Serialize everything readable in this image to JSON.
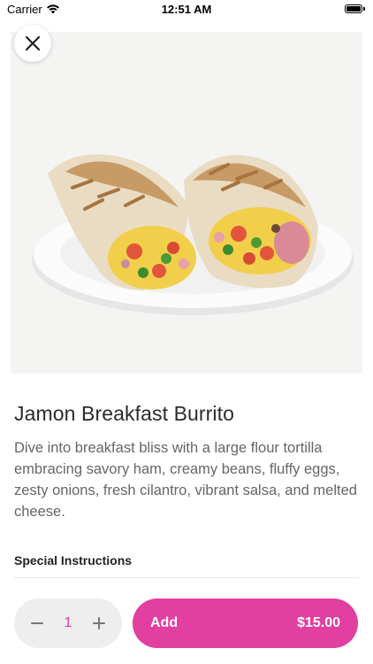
{
  "status_bar": {
    "carrier": "Carrier",
    "time": "12:51 AM"
  },
  "item": {
    "title": "Jamon Breakfast Burrito",
    "description": "Dive into breakfast bliss with a large flour tortilla embracing savory ham, creamy beans, fluffy eggs, zesty onions, fresh cilantro, vibrant salsa, and melted cheese."
  },
  "special_instructions": {
    "label": "Special Instructions"
  },
  "order": {
    "quantity": "1",
    "add_label": "Add",
    "price": "$15.00"
  },
  "icons": {
    "close": "close-icon",
    "minus": "minus-icon",
    "plus": "plus-icon",
    "wifi": "wifi-icon",
    "battery": "battery-icon"
  },
  "colors": {
    "accent": "#e23fa0",
    "stepper_bg": "#eeeeee"
  }
}
